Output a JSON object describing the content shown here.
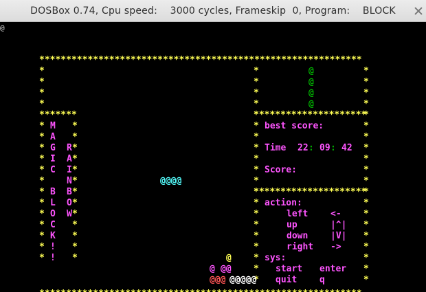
{
  "window": {
    "title": "DOSBox 0.74, Cpu speed:    3000 cycles, Frameskip  0, Program:    BLOCK"
  },
  "screen": {
    "prompt_char": "@",
    "border_char": "*",
    "block_char": "@",
    "next_piece": [
      "@",
      "@",
      "@",
      "@"
    ],
    "falling_piece": "@@@@",
    "title_letters": {
      "col1": [
        "M",
        "A",
        "G",
        "I",
        "C",
        "",
        "B",
        "L",
        "O",
        "C",
        "K",
        "!",
        "!"
      ],
      "col2": [
        "",
        "",
        "R",
        "A",
        "I",
        "N",
        "B",
        "O",
        "W",
        "",
        "",
        "",
        ""
      ]
    },
    "best_score_label": "best score:",
    "time_label": "Time",
    "time_h": "22",
    "time_m": "09",
    "time_s": "42",
    "time_sep": ":",
    "score_label": "Score:",
    "action_label": "action:",
    "controls": [
      {
        "action": "left",
        "key": "<-"
      },
      {
        "action": "up",
        "key": "|^|"
      },
      {
        "action": "down",
        "key": "|V|"
      },
      {
        "action": "right",
        "key": "->"
      }
    ],
    "sys_label": "sys:",
    "sys_controls": [
      {
        "action": "start",
        "key": "enter"
      },
      {
        "action": "quit",
        "key": "q"
      }
    ],
    "stack_row1": "@",
    "stack_row2a": "@",
    "stack_row2b": "@@",
    "stack_row3_red": "@@@",
    "stack_row3_white": "@@@@@"
  },
  "colors": {
    "border": "#ffff55",
    "text": "#ff55ff",
    "next_piece": "#00aa00",
    "falling_piece": "#55ffff",
    "stack_red": "#ff5555",
    "stack_white": "#ffffff"
  }
}
